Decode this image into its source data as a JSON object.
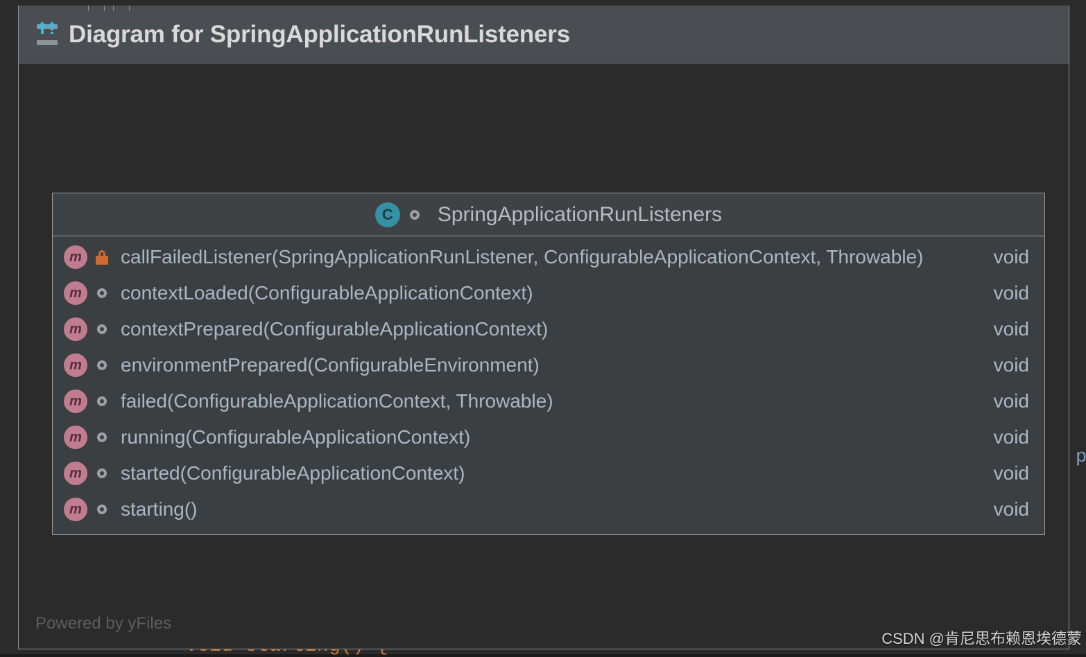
{
  "window": {
    "title": "Diagram for SpringApplicationRunListeners",
    "icon": "uml-diagram-icon"
  },
  "editor_background": {
    "visible_code_fragment": "void starting() {",
    "right_edge_fragment": "p"
  },
  "diagram": {
    "class_node": {
      "icon": "C",
      "visibility": "public",
      "name": "SpringApplicationRunListeners",
      "members": [
        {
          "icon": "m",
          "visibility": "private",
          "signature": "callFailedListener(SpringApplicationRunListener, ConfigurableApplicationContext, Throwable)",
          "type": "void"
        },
        {
          "icon": "m",
          "visibility": "public",
          "signature": "contextLoaded(ConfigurableApplicationContext)",
          "type": "void"
        },
        {
          "icon": "m",
          "visibility": "public",
          "signature": "contextPrepared(ConfigurableApplicationContext)",
          "type": "void"
        },
        {
          "icon": "m",
          "visibility": "public",
          "signature": "environmentPrepared(ConfigurableEnvironment)",
          "type": "void"
        },
        {
          "icon": "m",
          "visibility": "public",
          "signature": "failed(ConfigurableApplicationContext, Throwable)",
          "type": "void"
        },
        {
          "icon": "m",
          "visibility": "public",
          "signature": "running(ConfigurableApplicationContext)",
          "type": "void"
        },
        {
          "icon": "m",
          "visibility": "public",
          "signature": "started(ConfigurableApplicationContext)",
          "type": "void"
        },
        {
          "icon": "m",
          "visibility": "public",
          "signature": "starting()",
          "type": "void"
        }
      ]
    },
    "credit": "Powered by yFiles"
  },
  "watermark": {
    "text": "CSDN @肯尼思布赖恩埃德蒙"
  },
  "colors": {
    "canvas_background": "#2b2b2b",
    "titlebar_background": "#4a4d52",
    "class_box_background": "#3c3f41",
    "class_icon": "#3592a5",
    "method_icon": "#c27c90",
    "private_lock": "#cf6a30",
    "text_primary": "#a9b7c6",
    "accent_blue": "#40b6e0"
  }
}
